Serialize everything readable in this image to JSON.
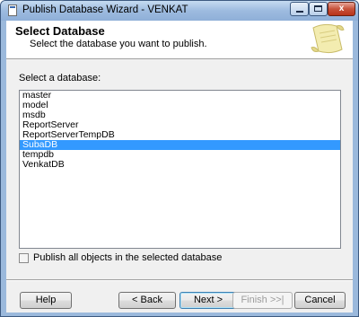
{
  "window": {
    "title": "Publish Database Wizard - VENKAT",
    "controls": {
      "minimize": "minimize",
      "maximize": "maximize",
      "close": "x"
    }
  },
  "header": {
    "title": "Select Database",
    "subtitle": "Select the database you want to publish."
  },
  "main": {
    "list_label": "Select a database:",
    "databases": [
      "master",
      "model",
      "msdb",
      "ReportServer",
      "ReportServerTempDB",
      "SubaDB",
      "tempdb",
      "VenkatDB"
    ],
    "selected": "SubaDB",
    "publish_all_checkbox": {
      "label": "Publish all objects in the selected database",
      "checked": false
    }
  },
  "buttons": {
    "help": "Help",
    "back": "< Back",
    "next": "Next >",
    "finish": "Finish >>|",
    "cancel": "Cancel"
  },
  "colors": {
    "selection": "#3399ff",
    "title_gradient": "#9dbbdf",
    "close_button": "#c7523a"
  }
}
